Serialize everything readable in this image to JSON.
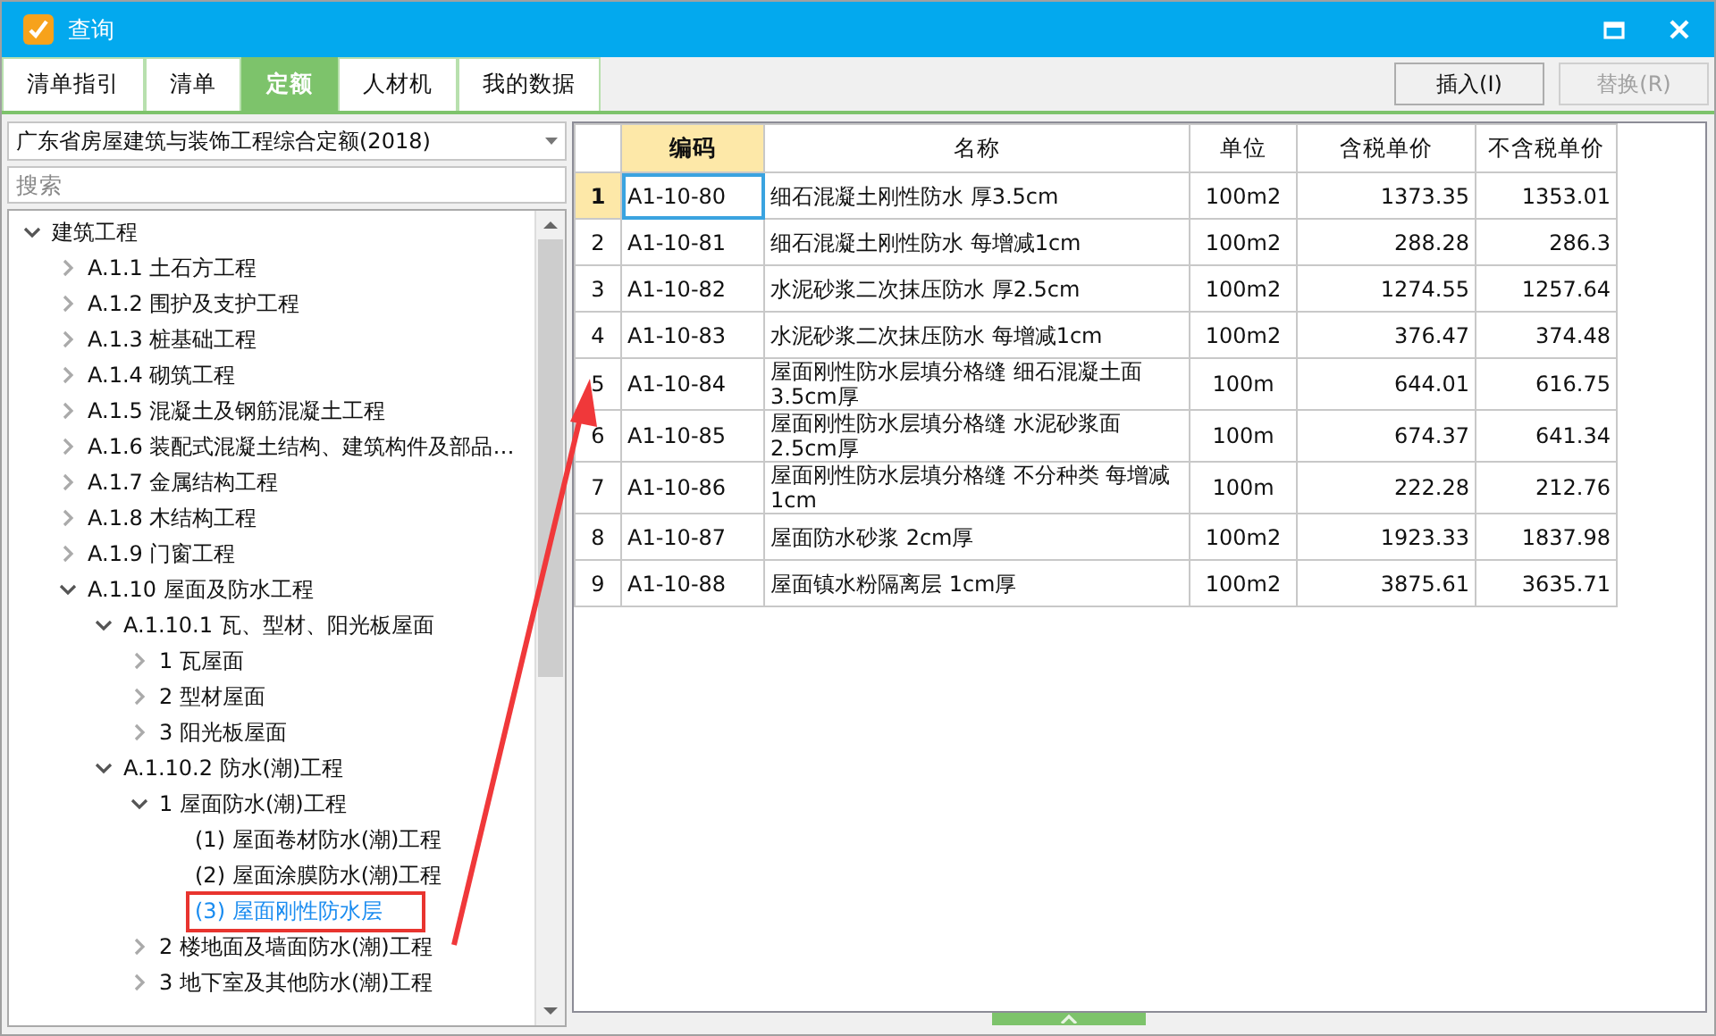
{
  "window": {
    "title": "查询"
  },
  "tabs": [
    {
      "label": "清单指引",
      "selected": false
    },
    {
      "label": "清单",
      "selected": false
    },
    {
      "label": "定额",
      "selected": true
    },
    {
      "label": "人材机",
      "selected": false
    },
    {
      "label": "我的数据",
      "selected": false
    }
  ],
  "actions": [
    {
      "label": "插入(I)",
      "disabled": false
    },
    {
      "label": "替换(R)",
      "disabled": true
    }
  ],
  "library_select": {
    "value": "广东省房屋建筑与装饰工程综合定额(2018)"
  },
  "search": {
    "placeholder": "搜索"
  },
  "tree": [
    {
      "label": "建筑工程",
      "expanded": true,
      "children": [
        {
          "label": "A.1.1 土石方工程",
          "expanded": false
        },
        {
          "label": "A.1.2 围护及支护工程",
          "expanded": false
        },
        {
          "label": "A.1.3 桩基础工程",
          "expanded": false
        },
        {
          "label": "A.1.4 砌筑工程",
          "expanded": false
        },
        {
          "label": "A.1.5 混凝土及钢筋混凝土工程",
          "expanded": false
        },
        {
          "label": "A.1.6 装配式混凝土结构、建筑构件及部品…",
          "expanded": false
        },
        {
          "label": "A.1.7 金属结构工程",
          "expanded": false
        },
        {
          "label": "A.1.8 木结构工程",
          "expanded": false
        },
        {
          "label": "A.1.9 门窗工程",
          "expanded": false
        },
        {
          "label": "A.1.10 屋面及防水工程",
          "expanded": true,
          "children": [
            {
              "label": "A.1.10.1 瓦、型材、阳光板屋面",
              "expanded": true,
              "children": [
                {
                  "label": "1 瓦屋面",
                  "expanded": false
                },
                {
                  "label": "2 型材屋面",
                  "expanded": false
                },
                {
                  "label": "3 阳光板屋面",
                  "expanded": false
                }
              ]
            },
            {
              "label": "A.1.10.2 防水(潮)工程",
              "expanded": true,
              "children": [
                {
                  "label": "1 屋面防水(潮)工程",
                  "expanded": true,
                  "children": [
                    {
                      "label": "(1) 屋面卷材防水(潮)工程",
                      "selected": false,
                      "annotated": false
                    },
                    {
                      "label": "(2) 屋面涂膜防水(潮)工程",
                      "selected": false,
                      "annotated": false
                    },
                    {
                      "label": "(3) 屋面刚性防水层",
                      "selected": true,
                      "annotated": true
                    }
                  ]
                },
                {
                  "label": "2 楼地面及墙面防水(潮)工程",
                  "expanded": false
                },
                {
                  "label": "3 地下室及其他防水(潮)工程",
                  "expanded": false
                }
              ]
            }
          ]
        }
      ]
    }
  ],
  "table": {
    "columns": [
      {
        "label": "编码",
        "selected": true
      },
      {
        "label": "名称",
        "selected": false
      },
      {
        "label": "单位",
        "selected": false
      },
      {
        "label": "含税单价",
        "selected": false
      },
      {
        "label": "不含税单价",
        "selected": false
      }
    ],
    "rows": [
      {
        "number": "1",
        "selected": true,
        "cells": [
          "A1-10-80",
          "细石混凝土刚性防水 厚3.5cm",
          "100m2",
          "1373.35",
          "1353.01"
        ]
      },
      {
        "number": "2",
        "selected": false,
        "cells": [
          "A1-10-81",
          "细石混凝土刚性防水 每增减1cm",
          "100m2",
          "288.28",
          "286.3"
        ]
      },
      {
        "number": "3",
        "selected": false,
        "cells": [
          "A1-10-82",
          "水泥砂浆二次抹压防水 厚2.5cm",
          "100m2",
          "1274.55",
          "1257.64"
        ]
      },
      {
        "number": "4",
        "selected": false,
        "cells": [
          "A1-10-83",
          "水泥砂浆二次抹压防水 每增减1cm",
          "100m2",
          "376.47",
          "374.48"
        ]
      },
      {
        "number": "5",
        "selected": false,
        "cells": [
          "A1-10-84",
          "屋面刚性防水层填分格缝 细石混凝土面3.5cm厚",
          "100m",
          "644.01",
          "616.75"
        ]
      },
      {
        "number": "6",
        "selected": false,
        "cells": [
          "A1-10-85",
          "屋面刚性防水层填分格缝 水泥砂浆面 2.5cm厚",
          "100m",
          "674.37",
          "641.34"
        ]
      },
      {
        "number": "7",
        "selected": false,
        "cells": [
          "A1-10-86",
          "屋面刚性防水层填分格缝 不分种类 每增减1cm",
          "100m",
          "222.28",
          "212.76"
        ]
      },
      {
        "number": "8",
        "selected": false,
        "cells": [
          "A1-10-87",
          "屋面防水砂浆 2cm厚",
          "100m2",
          "1923.33",
          "1837.98"
        ]
      },
      {
        "number": "9",
        "selected": false,
        "cells": [
          "A1-10-88",
          "屋面镇水粉隔离层 1cm厚",
          "100m2",
          "3875.61",
          "3635.71"
        ]
      }
    ]
  },
  "arrow": true
}
